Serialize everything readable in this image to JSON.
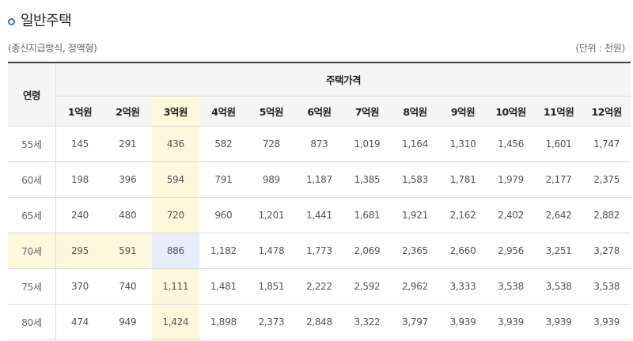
{
  "title": "일반주택",
  "subtitle_left": "(종신지급방식, 정액형)",
  "subtitle_right": "(단위 : 천원)",
  "table": {
    "age_header": "연령",
    "group_header": "주택가격",
    "columns": [
      "1억원",
      "2억원",
      "3억원",
      "4억원",
      "5억원",
      "6억원",
      "7억원",
      "8억원",
      "9억원",
      "10억원",
      "11억원",
      "12억원"
    ],
    "rows": [
      {
        "age": "55세",
        "values": [
          "145",
          "291",
          "436",
          "582",
          "728",
          "873",
          "1,019",
          "1,164",
          "1,310",
          "1,456",
          "1,601",
          "1,747"
        ]
      },
      {
        "age": "60세",
        "values": [
          "198",
          "396",
          "594",
          "791",
          "989",
          "1,187",
          "1,385",
          "1,583",
          "1,781",
          "1,979",
          "2,177",
          "2,375"
        ]
      },
      {
        "age": "65세",
        "values": [
          "240",
          "480",
          "720",
          "960",
          "1,201",
          "1,441",
          "1,681",
          "1,921",
          "2,162",
          "2,402",
          "2,642",
          "2,882"
        ]
      },
      {
        "age": "70세",
        "values": [
          "295",
          "591",
          "886",
          "1,182",
          "1,478",
          "1,773",
          "2,069",
          "2,365",
          "2,660",
          "2,956",
          "3,251",
          "3,278"
        ]
      },
      {
        "age": "75세",
        "values": [
          "370",
          "740",
          "1,111",
          "1,481",
          "1,851",
          "2,222",
          "2,592",
          "2,962",
          "3,333",
          "3,538",
          "3,538",
          "3,538"
        ]
      },
      {
        "age": "80세",
        "values": [
          "474",
          "949",
          "1,424",
          "1,898",
          "2,373",
          "2,848",
          "3,322",
          "3,797",
          "3,939",
          "3,939",
          "3,939",
          "3,939"
        ]
      }
    ],
    "highlight_column": 2,
    "highlight_row": 3,
    "colors": {
      "highlight": "#fdf8dc",
      "intersection": "#e8edfa",
      "header_bg": "#f5f5f5"
    }
  }
}
